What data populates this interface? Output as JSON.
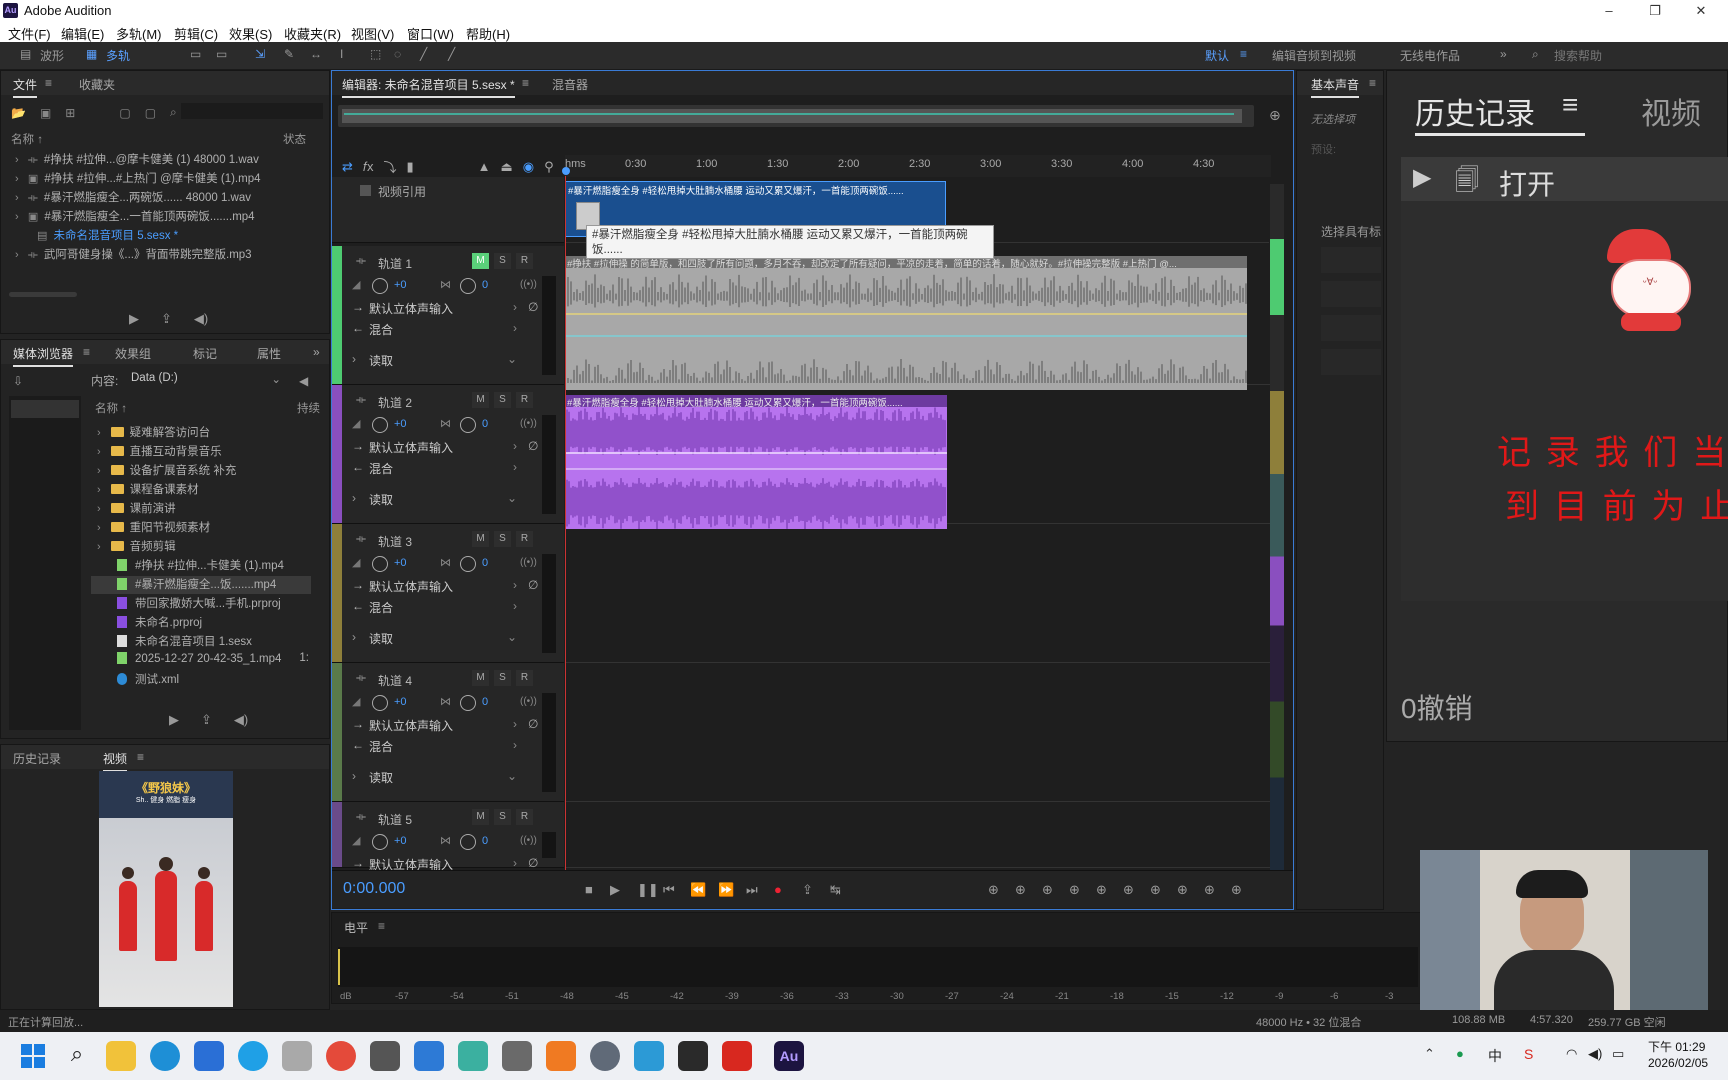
{
  "app": {
    "logo": "Au",
    "title": "Adobe Audition",
    "win_min": "–",
    "win_max": "❐",
    "win_close": "✕"
  },
  "menu": [
    "文件(F)",
    "编辑(E)",
    "多轨(M)",
    "剪辑(C)",
    "效果(S)",
    "收藏夹(R)",
    "视图(V)",
    "窗口(W)",
    "帮助(H)"
  ],
  "toolbar": {
    "waveform": "波形",
    "multitrack": "多轨",
    "workspace_default": "默认",
    "workspace_edit_video": "编辑音频到视频",
    "workspace_no_work": "无线电作品",
    "search_placeholder": "搜索帮助"
  },
  "files_panel": {
    "tab_files": "文件",
    "tab_favorites": "收藏夹",
    "col_name": "名称 ↑",
    "col_status": "状态",
    "items": [
      "#挣扶 #拉伸...@摩卡健美 (1) 48000 1.wav",
      "#挣扶 #拉伸...#上热门 @摩卡健美 (1).mp4",
      "#暴汗燃脂瘦全...两碗饭...... 48000 1.wav",
      "#暴汗燃脂瘦全...一首能顶两碗饭.......mp4",
      "未命名混音项目 5.sesx *",
      "武阿哥健身操《...》背面带跳完整版.mp3"
    ]
  },
  "media_browser": {
    "tab_media": "媒体浏览器",
    "tab_effects": "效果组",
    "tab_markers": "标记",
    "tab_props": "属性",
    "content_label": "内容:",
    "content_value": "Data (D:)",
    "col_name": "名称 ↑",
    "col_dur": "持续",
    "items": [
      "疑难解答访问台",
      "直播互动背景音乐",
      "设备扩展音系统 补充",
      "课程备课素材",
      "课前演讲",
      "重阳节视频素材",
      "音频剪辑",
      "#挣扶 #拉伸...卡健美 (1).mp4",
      "#暴汗燃脂瘦全...饭.......mp4",
      "带回家撒娇大喊...手机.prproj",
      "未命名.prproj",
      "未命名混音项目 1.sesx",
      "2025-12-27 20-42-35_1.mp4",
      "测试.xml"
    ],
    "dur_item": "1:"
  },
  "bottom_left": {
    "tab_history": "历史记录",
    "tab_video": "视频",
    "video_title": "《野狼妹》",
    "video_sub": "Sh..  健身 燃脂 瘦身"
  },
  "editor": {
    "tab_editor": "编辑器: 未命名混音项目 5.sesx *",
    "tab_mixer": "混音器",
    "ruler_unit": "hms",
    "ruler_ticks": [
      "0:30",
      "1:00",
      "1:30",
      "2:00",
      "2:30",
      "3:00",
      "3:30",
      "4:00",
      "4:30"
    ],
    "video_ref": "视频引用",
    "video_clip_title": "#暴汗燃脂瘦全身 #轻松甩掉大肚腩水桶腰 运动又累又爆汗，一首能顶两碗饭......",
    "tooltip": "#暴汗燃脂瘦全身 #轻松甩掉大肚腩水桶腰 运动又累又爆汗，一首能顶两碗饭......",
    "clip1_title": "#挣扶 #拉伸操 的简单版，和四肢了所有问题，多月不吞，却改定了所有疑问，平凉的走着，简单的话着，随心就好。#拉伸操完整版 #上热门 @...",
    "clip2_title": "#暴汗燃脂瘦全身 #轻松甩掉大肚腩水桶腰 运动又累又爆汗，一首能顶两碗饭......",
    "tracks": [
      {
        "name": "轨道 1",
        "vol": "+0",
        "pan": "0",
        "input": "默认立体声输入",
        "output": "混合",
        "mode": "读取"
      },
      {
        "name": "轨道 2",
        "vol": "+0",
        "pan": "0",
        "input": "默认立体声输入",
        "output": "混合",
        "mode": "读取"
      },
      {
        "name": "轨道 3",
        "vol": "+0",
        "pan": "0",
        "input": "默认立体声输入",
        "output": "混合",
        "mode": "读取"
      },
      {
        "name": "轨道 4",
        "vol": "+0",
        "pan": "0",
        "input": "默认立体声输入",
        "output": "混合",
        "mode": "读取"
      },
      {
        "name": "轨道 5",
        "vol": "+0",
        "pan": "0",
        "input": "默认立体声输入"
      }
    ],
    "m": "M",
    "s": "S",
    "r": "R",
    "time": "0:00.000"
  },
  "levels": {
    "title": "电平",
    "scale": [
      "dB",
      "-57",
      "-54",
      "-51",
      "-48",
      "-45",
      "-42",
      "-39",
      "-36",
      "-33",
      "-30",
      "-27",
      "-24",
      "-21",
      "-18",
      "-15",
      "-12",
      "-9",
      "-6",
      "-3"
    ]
  },
  "basic_sound": {
    "title": "基本声音",
    "no_selection": "无选择项",
    "preset": "预设:",
    "choose": "选择具有标"
  },
  "history": {
    "tab_history": "历史记录",
    "tab_video": "视频",
    "open": "打开",
    "undo": "0撤销",
    "overlay_line1": "记 录 我 们 当",
    "overlay_line2": "到 目 前 为 止"
  },
  "status": {
    "left": "正在计算回放...",
    "format": "48000 Hz • 32 位混合",
    "size": "108.88 MB",
    "duration": "4:57.320",
    "free": "259.77 GB 空闲"
  },
  "taskbar": {
    "ime": "中",
    "time": "下午 01:29",
    "date": "2026/02/05"
  }
}
